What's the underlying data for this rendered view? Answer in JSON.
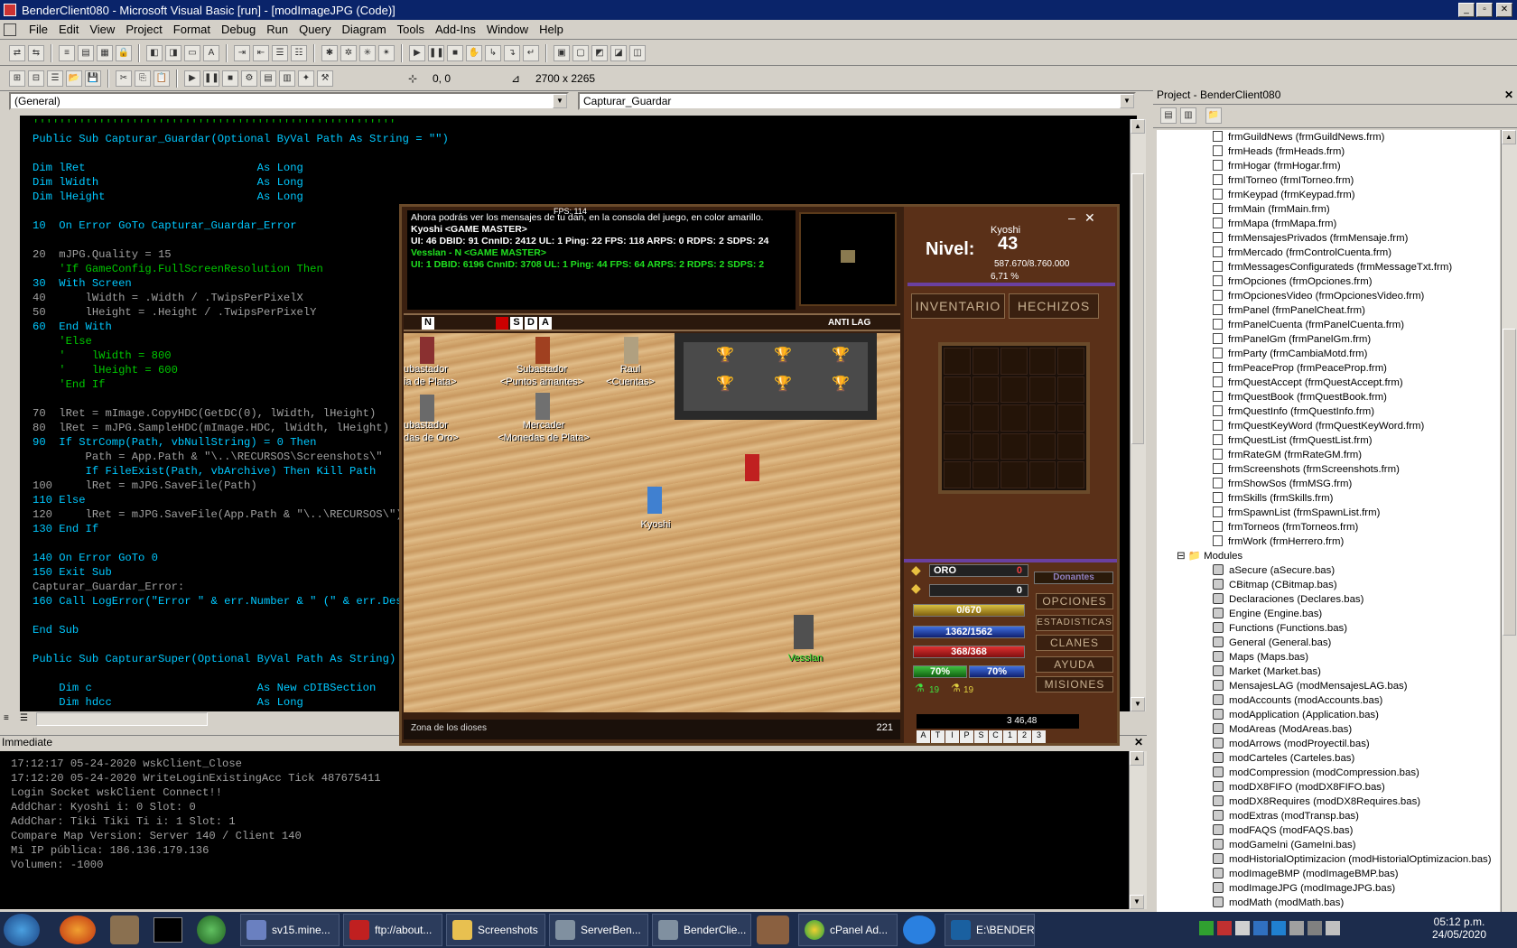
{
  "window": {
    "title": "BenderClient080 - Microsoft Visual Basic [run] - [modImageJPG (Code)]"
  },
  "menu": [
    "File",
    "Edit",
    "View",
    "Project",
    "Format",
    "Debug",
    "Run",
    "Query",
    "Diagram",
    "Tools",
    "Add-Ins",
    "Window",
    "Help"
  ],
  "toolbar": {
    "coords": "0, 0",
    "size": "2700 x 2265"
  },
  "combos": {
    "object": "(General)",
    "procedure": "Capturar_Guardar"
  },
  "code": [
    {
      "t": "'''''''''''''''''''''''''''''''''''''''''''''''''''''''",
      "c": "cm"
    },
    {
      "t": "Public Sub Capturar_Guardar(Optional ByVal Path As String = \"\")",
      "c": "kw"
    },
    {
      "t": "",
      "c": "tx"
    },
    {
      "t": "Dim lRet                          As Long",
      "c": "kw"
    },
    {
      "t": "Dim lWidth                        As Long",
      "c": "kw"
    },
    {
      "t": "Dim lHeight                       As Long",
      "c": "kw"
    },
    {
      "t": "",
      "c": "tx"
    },
    {
      "t": "10  On Error GoTo Capturar_Guardar_Error",
      "c": "kw"
    },
    {
      "t": "",
      "c": "tx"
    },
    {
      "t": "20  mJPG.Quality = 15",
      "c": "tx"
    },
    {
      "t": "    'If GameConfig.FullScreenResolution Then",
      "c": "cm"
    },
    {
      "t": "30  With Screen",
      "c": "kw"
    },
    {
      "t": "40      lWidth = .Width / .TwipsPerPixelX",
      "c": "tx"
    },
    {
      "t": "50      lHeight = .Height / .TwipsPerPixelY",
      "c": "tx"
    },
    {
      "t": "60  End With",
      "c": "kw"
    },
    {
      "t": "    'Else",
      "c": "cm"
    },
    {
      "t": "    '    lWidth = 800",
      "c": "cm"
    },
    {
      "t": "    '    lHeight = 600",
      "c": "cm"
    },
    {
      "t": "    'End If",
      "c": "cm"
    },
    {
      "t": "",
      "c": "tx"
    },
    {
      "t": "70  lRet = mImage.CopyHDC(GetDC(0), lWidth, lHeight)",
      "c": "tx"
    },
    {
      "t": "80  lRet = mJPG.SampleHDC(mImage.HDC, lWidth, lHeight)",
      "c": "tx"
    },
    {
      "t": "90  If StrComp(Path, vbNullString) = 0 Then",
      "c": "kw"
    },
    {
      "t": "        Path = App.Path & \"\\..\\RECURSOS\\Screenshots\\\"",
      "c": "tx"
    },
    {
      "t": "        If FileExist(Path, vbArchive) Then Kill Path",
      "c": "kw"
    },
    {
      "t": "100     lRet = mJPG.SaveFile(Path)",
      "c": "tx"
    },
    {
      "t": "110 Else",
      "c": "kw"
    },
    {
      "t": "120     lRet = mJPG.SaveFile(App.Path & \"\\..\\RECURSOS\\\")",
      "c": "tx"
    },
    {
      "t": "130 End If",
      "c": "kw"
    },
    {
      "t": "",
      "c": "tx"
    },
    {
      "t": "140 On Error GoTo 0",
      "c": "kw"
    },
    {
      "t": "150 Exit Sub",
      "c": "kw"
    },
    {
      "t": "Capturar_Guardar_Error:",
      "c": "tx"
    },
    {
      "t": "160 Call LogError(\"Error \" & err.Number & \" (\" & err.Description)",
      "c": "kw"
    },
    {
      "t": "",
      "c": "tx"
    },
    {
      "t": "End Sub",
      "c": "kw"
    },
    {
      "t": "",
      "c": "tx"
    },
    {
      "t": "Public Sub CapturarSuper(Optional ByVal Path As String)",
      "c": "kw"
    },
    {
      "t": "",
      "c": "tx"
    },
    {
      "t": "    Dim c                         As New cDIBSection",
      "c": "kw"
    },
    {
      "t": "    Dim hdcc                      As Long",
      "c": "kw"
    }
  ],
  "immediate": {
    "title": "Immediate",
    "lines": [
      "17:12:17 05-24-2020 wskClient_Close",
      "17:12:20 05-24-2020 WriteLoginExistingAcc Tick 487675411",
      "Login Socket wskClient Connect!!",
      "AddChar: Kyoshi i: 0 Slot: 0",
      "AddChar: Tiki Tiki Ti i: 1 Slot: 1",
      "Compare Map Version: Server 140 / Client 140",
      "Mi IP pública: 186.136.179.136",
      "Volumen: -1000"
    ]
  },
  "project": {
    "title": "Project - BenderClient080",
    "forms": [
      "frmGuildNews (frmGuildNews.frm)",
      "frmHeads (frmHeads.frm)",
      "frmHogar (frmHogar.frm)",
      "frmITorneo (frmITorneo.frm)",
      "frmKeypad (frmKeypad.frm)",
      "frmMain (frmMain.frm)",
      "frmMapa (frmMapa.frm)",
      "frmMensajesPrivados (frmMensaje.frm)",
      "frmMercado (frmControlCuenta.frm)",
      "frmMessagesConfigurateds (frmMessageTxt.frm)",
      "frmOpciones (frmOpciones.frm)",
      "frmOpcionesVideo (frmOpcionesVideo.frm)",
      "frmPanel (frmPanelCheat.frm)",
      "frmPanelCuenta (frmPanelCuenta.frm)",
      "frmPanelGm (frmPanelGm.frm)",
      "frmParty (frmCambiaMotd.frm)",
      "frmPeaceProp (frmPeaceProp.frm)",
      "frmQuestAccept (frmQuestAccept.frm)",
      "frmQuestBook (frmQuestBook.frm)",
      "frmQuestInfo (frmQuestInfo.frm)",
      "frmQuestKeyWord (frmQuestKeyWord.frm)",
      "frmQuestList (frmQuestList.frm)",
      "frmRateGM (frmRateGM.frm)",
      "frmScreenshots (frmScreenshots.frm)",
      "frmShowSos (frmMSG.frm)",
      "frmSkills (frmSkills.frm)",
      "frmSpawnList (frmSpawnList.frm)",
      "frmTorneos (frmTorneos.frm)",
      "frmWork (frmHerrero.frm)"
    ],
    "modules_label": "Modules",
    "modules": [
      "aSecure (aSecure.bas)",
      "CBitmap (CBitmap.bas)",
      "Declaraciones (Declares.bas)",
      "Engine (Engine.bas)",
      "Functions (Functions.bas)",
      "General (General.bas)",
      "Maps (Maps.bas)",
      "Market (Market.bas)",
      "MensajesLAG (modMensajesLAG.bas)",
      "modAccounts (modAccounts.bas)",
      "modApplication (Application.bas)",
      "ModAreas (ModAreas.bas)",
      "modArrows (modProyectil.bas)",
      "modCarteles (Carteles.bas)",
      "modCompression (modCompression.bas)",
      "modDX8FIFO (modDX8FIFO.bas)",
      "modDX8Requires (modDX8Requires.bas)",
      "modExtras (modTransp.bas)",
      "modFAQS (modFAQS.bas)",
      "modGameIni (GameIni.bas)",
      "modHistorialOptimizacion (modHistorialOptimizacion.bas)",
      "modImageBMP (modImageBMP.bas)",
      "modImageJPG (modImageJPG.bas)",
      "modMath (modMath.bas)"
    ]
  },
  "game": {
    "fps": "FPS: 114",
    "console": [
      {
        "t": "Ahora podrás ver los mensajes de tu dan, en la consola del juego, en color amarillo.",
        "c": "#ffffff"
      },
      {
        "t": "Kyoshi <GAME MASTER>",
        "c": "#ffffff"
      },
      {
        "t": "UI: 46 DBID: 91 CnnID: 2412 UL: 1 Ping: 22 FPS: 118 ARPS: 0 RDPS: 2 SDPS: 24",
        "c": "#ffffff"
      },
      {
        "t": "Vesslan - N <GAME MASTER>",
        "c": "#20e020"
      },
      {
        "t": "UI: 1 DBID: 6196 CnnID: 3708 UL: 1 Ping: 44 FPS: 64 ARPS: 2 RDPS: 2 SDPS: 2",
        "c": "#20e020"
      }
    ],
    "modes": [
      "N",
      "S",
      "D",
      "A"
    ],
    "antilag": "ANTI LAG",
    "npcs": [
      {
        "name": "ubastador",
        "sub": "ia de Plata>"
      },
      {
        "name": "Subastador",
        "sub": "<Puntos amantes>"
      },
      {
        "name": "Raul",
        "sub": "<Cuentas>"
      },
      {
        "name": "ubastador",
        "sub": "das de Oro>"
      },
      {
        "name": "Mercader",
        "sub": "<Monedas de Plata>"
      }
    ],
    "player": "Kyoshi",
    "other": "Vesslan",
    "zone": "Zona de los dioses",
    "zone_num": "221",
    "level_label": "Nivel:",
    "level": "43",
    "char_name": "Kyoshi",
    "exp": "587.670/8.760.000",
    "exp_pct": "6,71 %",
    "tabs": [
      "INVENTARIO",
      "HECHIZOS"
    ],
    "oro_label": "ORO",
    "oro": "0",
    "gold2": "0",
    "donate": "Donantes",
    "bars": {
      "food": "0/670",
      "mana": "1362/1562",
      "hp": "368/368",
      "hunger": "70%",
      "thirst": "70%"
    },
    "potions": [
      "19",
      "19"
    ],
    "menu_buttons": [
      "OPCIONES",
      "ESTADISTICAS",
      "CLANES",
      "AYUDA",
      "MISIONES"
    ],
    "coords": "3   46,48",
    "hotkeys": [
      "A",
      "T",
      "I",
      "P",
      "S",
      "C",
      "1",
      "2",
      "3"
    ]
  },
  "taskbar": {
    "items": [
      "sv15.mine...",
      "ftp://about...",
      "Screenshots",
      "ServerBen...",
      "BenderClie...",
      "cPanel Ad...",
      "E:\\BENDER..."
    ],
    "time": "05:12 p.m.",
    "date": "24/05/2020"
  }
}
